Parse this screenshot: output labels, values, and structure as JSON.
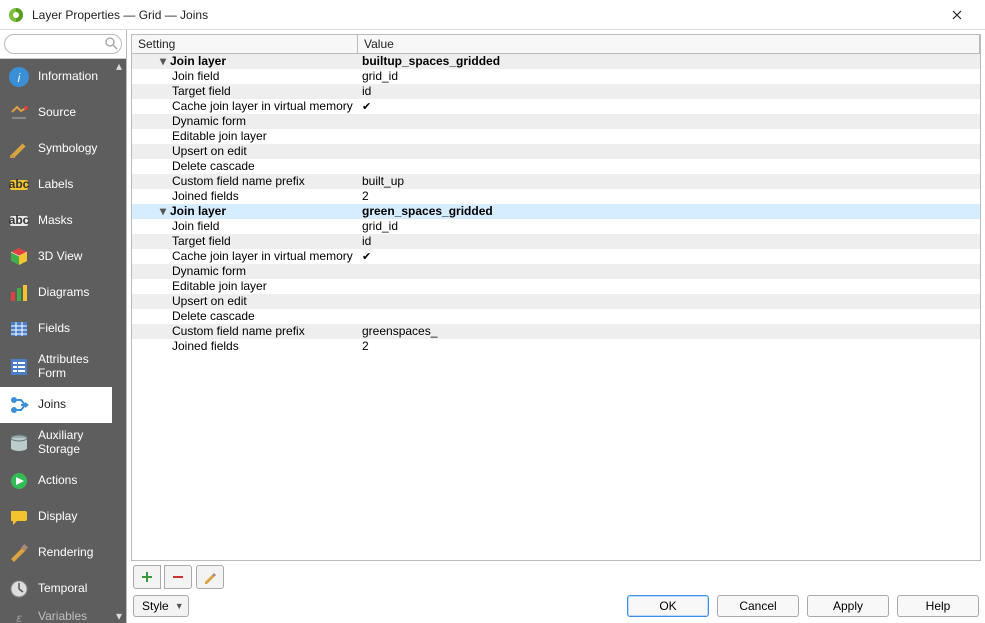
{
  "window": {
    "title": "Layer Properties — Grid — Joins"
  },
  "search": {
    "placeholder": ""
  },
  "sidebar": {
    "items": [
      {
        "label": "Information"
      },
      {
        "label": "Source"
      },
      {
        "label": "Symbology"
      },
      {
        "label": "Labels"
      },
      {
        "label": "Masks"
      },
      {
        "label": "3D View"
      },
      {
        "label": "Diagrams"
      },
      {
        "label": "Fields"
      },
      {
        "label": "Attributes Form"
      },
      {
        "label": "Joins"
      },
      {
        "label": "Auxiliary Storage"
      },
      {
        "label": "Actions"
      },
      {
        "label": "Display"
      },
      {
        "label": "Rendering"
      },
      {
        "label": "Temporal"
      },
      {
        "label": "Variables"
      }
    ],
    "active_index": 9
  },
  "grid": {
    "columns": {
      "setting": "Setting",
      "value": "Value"
    },
    "selected_row_index": 10,
    "rows": [
      {
        "kind": "parent",
        "setting": "Join layer",
        "value": "builtup_spaces_gridded"
      },
      {
        "kind": "child",
        "setting": "Join field",
        "value": "grid_id"
      },
      {
        "kind": "child",
        "setting": "Target field",
        "value": "id"
      },
      {
        "kind": "child",
        "setting": "Cache join layer in virtual memory",
        "value_check": true
      },
      {
        "kind": "child",
        "setting": "Dynamic form",
        "value": ""
      },
      {
        "kind": "child",
        "setting": "Editable join layer",
        "value": ""
      },
      {
        "kind": "child",
        "setting": "Upsert on edit",
        "value": ""
      },
      {
        "kind": "child",
        "setting": "Delete cascade",
        "value": ""
      },
      {
        "kind": "child",
        "setting": "Custom field name prefix",
        "value": "built_up"
      },
      {
        "kind": "child",
        "setting": "Joined fields",
        "value": "2"
      },
      {
        "kind": "parent",
        "setting": "Join layer",
        "value": "green_spaces_gridded"
      },
      {
        "kind": "child",
        "setting": "Join field",
        "value": "grid_id"
      },
      {
        "kind": "child",
        "setting": "Target field",
        "value": "id"
      },
      {
        "kind": "child",
        "setting": "Cache join layer in virtual memory",
        "value_check": true
      },
      {
        "kind": "child",
        "setting": "Dynamic form",
        "value": ""
      },
      {
        "kind": "child",
        "setting": "Editable join layer",
        "value": ""
      },
      {
        "kind": "child",
        "setting": "Upsert on edit",
        "value": ""
      },
      {
        "kind": "child",
        "setting": "Delete cascade",
        "value": ""
      },
      {
        "kind": "child",
        "setting": "Custom field name prefix",
        "value": "greenspaces_"
      },
      {
        "kind": "child",
        "setting": "Joined fields",
        "value": "2"
      }
    ]
  },
  "toolbar": {
    "add_label": "Add join",
    "remove_label": "Remove join",
    "edit_label": "Edit join"
  },
  "footer": {
    "style": "Style",
    "ok": "OK",
    "cancel": "Cancel",
    "apply": "Apply",
    "help": "Help"
  },
  "icons": {
    "information": "info-icon",
    "source": "source-icon",
    "symbology": "symbology-icon",
    "labels": "labels-icon",
    "masks": "masks-icon",
    "3dview": "cube-icon",
    "diagrams": "diagrams-icon",
    "fields": "fields-icon",
    "attributes_form": "form-icon",
    "joins": "joins-icon",
    "auxiliary_storage": "storage-icon",
    "actions": "actions-icon",
    "display": "display-icon",
    "rendering": "rendering-icon",
    "temporal": "temporal-icon",
    "variables": "variables-icon"
  }
}
